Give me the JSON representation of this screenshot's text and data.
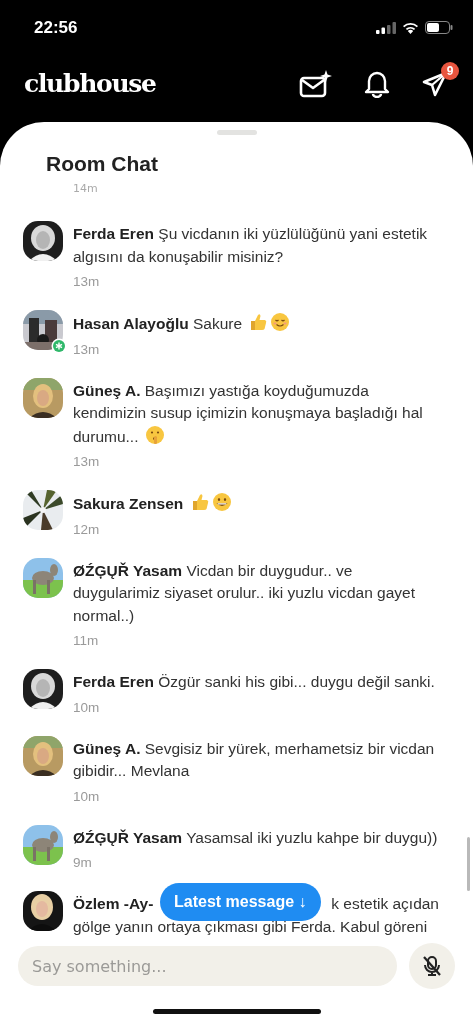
{
  "status_bar": {
    "time": "22:56"
  },
  "header": {
    "logo": "clubhouse",
    "notifications_badge": "9"
  },
  "room_chat": {
    "title": "Room Chat",
    "top_time": "14m",
    "messages": [
      {
        "name": "Ferda Eren",
        "text": "Şu vicdanın iki yüzlülüğünü yani estetik algısını da konuşabilir misiniz?",
        "badge": false,
        "time": "13m",
        "avatar": {
          "kind": "picture"
        }
      },
      {
        "name": "Hasan Alayoğlu",
        "text": "Sakure",
        "emojis": [
          {
            "kind": "thumbs"
          },
          {
            "kind": "smiling"
          }
        ],
        "badge": true,
        "time": "13m",
        "avatar": {
          "kind": "picture"
        }
      },
      {
        "name": "Güneş A.",
        "text": "Başımızı yastığa koyduğumuzda kendimizin susup içimizin konuşmaya başladığı hal durumu...",
        "emojis": [
          {
            "kind": "shushing"
          }
        ],
        "badge": false,
        "time": "13m",
        "avatar": {
          "kind": "picture"
        }
      },
      {
        "name": "Sakura Zensen",
        "emojis": [
          {
            "kind": "thumbs"
          },
          {
            "kind": "grinning"
          }
        ],
        "badge": false,
        "time": "12m",
        "avatar": {
          "kind": "picture"
        }
      },
      {
        "name": "ØŹĢŲŘ Yasam",
        "text": "Vicdan bir duygudur.. ve duygularimiz siyaset orulur.. iki yuzlu vicdan gayet normal..)",
        "badge": false,
        "time": "11m",
        "avatar": {
          "kind": "picture"
        }
      },
      {
        "name": "Ferda Eren",
        "text": "Özgür sanki his gibi... duygu değil sanki.",
        "badge": false,
        "time": "10m",
        "avatar": {
          "kind": "picture"
        }
      },
      {
        "name": "Güneş A.",
        "text": "Sevgisiz bir yürek, merhametsiz bir vicdan gibidir... Mevlana",
        "badge": false,
        "time": "10m",
        "avatar": {
          "kind": "picture"
        }
      },
      {
        "name": "ØŹĢŲŘ Yasam",
        "text": "Yasamsal iki yuzlu kahpe bir duygu))",
        "badge": false,
        "time": "9m",
        "avatar": {
          "kind": "picture"
        }
      },
      {
        "name": "Özlem -Ay-",
        "text_parts": [
          "k estetik açıdan",
          "gölge yanın ortaya çıkması gibi Ferda. Kabul göreni"
        ],
        "badge": false,
        "avatar": {
          "kind": "picture"
        }
      }
    ],
    "latest_button": "Latest message ↓",
    "composer": {
      "placeholder": "Say something...",
      "mic_muted": true
    }
  }
}
